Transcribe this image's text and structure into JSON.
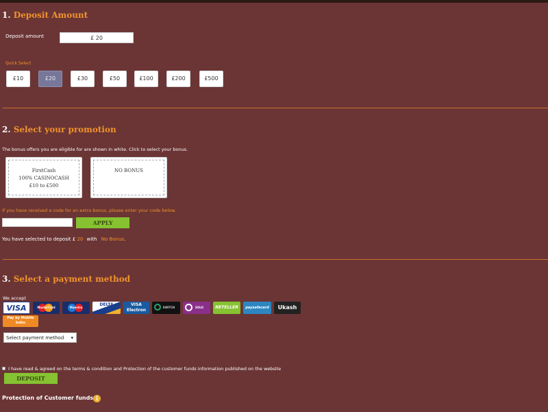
{
  "deposit": {
    "section_number": "1.",
    "section_title": "Deposit Amount",
    "amount_label": "Deposit amount",
    "amount_value": "£ 20",
    "quick_select_label": "Quick Select",
    "quick_select": [
      "£10",
      "£20",
      "£30",
      "£50",
      "£100",
      "£200",
      "£500"
    ],
    "selected_index": 1
  },
  "promotion": {
    "section_number": "2.",
    "section_title": "Select your promotion",
    "intro_text": "The bonus offers you are eligible for are shown in white. Click to select your bonus.",
    "bonuses": [
      {
        "line1": "FirstCash",
        "line2": "100% CASINOCASH",
        "line3": "£10 to £500"
      },
      {
        "line1": "NO BONUS",
        "line2": "",
        "line3": ""
      }
    ],
    "code_prompt": "If you have received a code for an extra bonus, please enter your code below.",
    "code_value": "",
    "apply_label": "APPLY",
    "summary_prefix": "You have selected to deposit £",
    "summary_amount": "20",
    "summary_with": "with",
    "summary_bonus": "No Bonus",
    "summary_end": "."
  },
  "payment": {
    "section_number": "3.",
    "section_title": "Select a payment method",
    "we_accept_label": "We accept",
    "methods": [
      "VISA",
      "MasterCard",
      "Maestro",
      "DELTA",
      "VISA Electron",
      "SWITCH",
      "SOLO",
      "NETELLER",
      "paysafecard",
      "Ukash",
      "Pay by Mobile boku"
    ],
    "select_value": "Select payment method",
    "select_arrow": "▾",
    "terms_text": "I have read & agreed on the terms & condition and Protection of the customer funds information published on the website",
    "deposit_label": "DEPOSIT",
    "protection_label": "Protection of Customer funds",
    "info_glyph": "i"
  },
  "colors": {
    "background": "#6b3535",
    "accent": "#f0932b",
    "button_green": "#86c232",
    "selected_quick": "#77779a"
  }
}
